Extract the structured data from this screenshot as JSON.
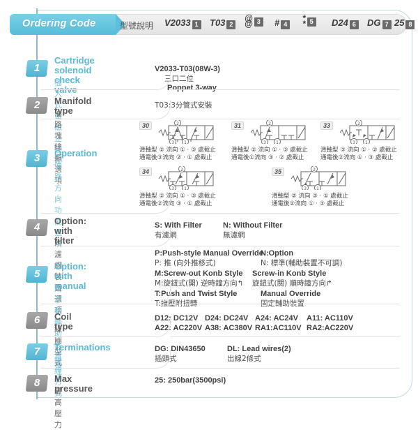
{
  "header": {
    "title": "Ordering Code",
    "title_cn": "型號說明",
    "codes": [
      {
        "value": "V2033",
        "index": "1"
      },
      {
        "value": "T03",
        "index": "2"
      },
      {
        "value": "@@",
        "index": "3"
      },
      {
        "value": "#",
        "index": "4"
      },
      {
        "value": "**",
        "index": "5"
      },
      {
        "value": "D24",
        "index": "6"
      },
      {
        "value": "DG",
        "index": "7"
      },
      {
        "value": "25",
        "index": "8"
      }
    ]
  },
  "rows": [
    {
      "num": "1",
      "accent": "blue",
      "label_en": "Cartridge solenoid\ncheck valve",
      "label_cn": "插入式電磁止回閥",
      "lines": [
        {
          "text": "V2033-T03(08W-3)",
          "kind": "en"
        },
        {
          "text": "三口二位",
          "kind": "cn"
        },
        {
          "text": "Poppet 3-way",
          "kind": "en"
        }
      ]
    },
    {
      "num": "2",
      "accent": "gray",
      "label_en": "Manifold type",
      "label_cn": "油路塊總類選項",
      "lines": [
        {
          "text": "T03:3分管式安裝",
          "kind": "cn"
        }
      ]
    },
    {
      "num": "3",
      "accent": "blue",
      "label_en": "Operation",
      "label_cn": "油路方向功能選項",
      "lines": []
    },
    {
      "num": "4",
      "accent": "gray",
      "label_en": "Option:\nwith filter",
      "label_cn": "附濾網裝置選項",
      "cols": [
        {
          "en": "S: With Filter",
          "cn": "有濾網"
        },
        {
          "en": "N: Without Filter",
          "cn": "無濾網"
        }
      ]
    },
    {
      "num": "5",
      "accent": "blue",
      "label_en": "Option:\nwith manual",
      "label_cn": "附手動輔助裝置選項",
      "manual": [
        {
          "a_en": "P:Push-style Manual Override",
          "a_cn": "P: 推 (向外推移式)",
          "b_en": "N:Option",
          "b_cn": "N: 標準(輔助裝置不可調)"
        },
        {
          "a_en": "M:Screw-out Konb Style",
          "a_cn": "M:旋鈕式(開) 逆時鐘方向↰",
          "b_en": "Screw-in Konb Style",
          "b_cn": "旋鈕式(關) 順時鐘方向↱"
        },
        {
          "a_en": "T:Push and Twist Style",
          "a_cn": "T:推壓附扭轉",
          "b_en": "Manual Override",
          "b_cn": "固定輔助裝置"
        }
      ]
    },
    {
      "num": "6",
      "accent": "gray",
      "label_en": "Coil type",
      "label_cn": "線圈型式",
      "grid": [
        [
          "D12: DC12V",
          "D24: DC24V",
          "A24: AC24V",
          "A11: AC110V"
        ],
        [
          "A22: AC220V",
          "A38: AC380V",
          "RA1:AC110V",
          "RA2:AC220V"
        ]
      ]
    },
    {
      "num": "7",
      "accent": "blue",
      "label_en": "Terminations",
      "label_cn": "接線方式",
      "cols": [
        {
          "en": "DG: DIN43650",
          "cn": "插頭式"
        },
        {
          "en": "DL: Lead wires(2)",
          "cn": "出線2條式"
        }
      ]
    },
    {
      "num": "8",
      "accent": "gray",
      "label_en": "Max pressure",
      "label_cn": "最高壓力",
      "lines": [
        {
          "text": "25: 250bar(3500psi)",
          "kind": "en"
        }
      ]
    }
  ],
  "symbols": [
    {
      "id": "30",
      "line1": "滑軸型 ② 流向 ① ‧ ③ 處截止",
      "line2": "通電後③流向 ② ‧ ① 處截止"
    },
    {
      "id": "31",
      "line1": "滑軸型 ② 流向 ① ‧ ③ 處截止",
      "line2": "通電後①流向 ③ ‧ ② 處截止"
    },
    {
      "id": "33",
      "line1": "滑軸型 ③ 流向 ① ‧ ② 處截止",
      "line2": "通電後②流向 ① ‧ ③ 處截止"
    },
    {
      "id": "34",
      "line1": "滑軸型 ② 流向 ① ‧ ③ 處截止",
      "line2": "通電後②流向 ③ ‧ ① 處截止"
    },
    {
      "id": "35",
      "line1": "滑軸型 ② 流向 ③ ‧ ① 處截止",
      "line2": "通電後②流向 ① ‧ ③ 處截止"
    }
  ],
  "ports": {
    "p1": "①",
    "p2": "②",
    "p3": "③"
  },
  "colors": {
    "accent_blue": "#5bb9d6",
    "accent_gray": "#8a8a8a",
    "frame": "#bcd9e4"
  }
}
